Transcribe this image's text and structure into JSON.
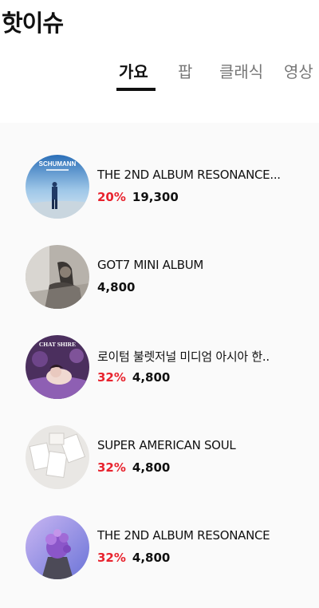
{
  "header": {
    "title": "핫이슈"
  },
  "tabs": [
    {
      "label": "가요",
      "active": true
    },
    {
      "label": "팝",
      "active": false
    },
    {
      "label": "클래식",
      "active": false
    },
    {
      "label": "영상",
      "active": false
    }
  ],
  "albums": [
    {
      "title": "THE 2ND ALBUM RESONANCE...",
      "discount": "20%",
      "price": "19,300",
      "cover_text": "SCHUMANN"
    },
    {
      "title": "GOT7 MINI ALBUM",
      "discount": "",
      "price": "4,800"
    },
    {
      "title": "로이텀 불렛저널 미디엄 아시아 한..",
      "discount": "32%",
      "price": "4,800",
      "cover_text": "CHAT SHIRE"
    },
    {
      "title": "SUPER AMERICAN SOUL",
      "discount": "32%",
      "price": "4,800"
    },
    {
      "title": "THE 2ND ALBUM RESONANCE",
      "discount": "32%",
      "price": "4,800"
    }
  ],
  "colors": {
    "accent_red": "#e8232e",
    "text": "#111111",
    "tab_inactive": "#777777",
    "list_bg": "#fafafa"
  }
}
